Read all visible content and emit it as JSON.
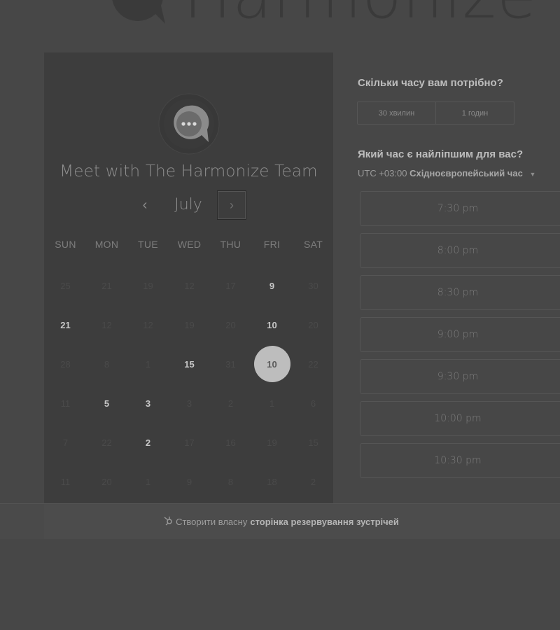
{
  "brand": {
    "name": "Harmonize"
  },
  "calendar": {
    "title": "Meet with The Harmonize Team",
    "month": "July",
    "prev_icon": "‹",
    "next_icon": "›",
    "weekdays": [
      "SUN",
      "MON",
      "TUE",
      "WED",
      "THU",
      "FRI",
      "SAT"
    ],
    "weeks": [
      [
        "25",
        "21",
        "19",
        "12",
        "17",
        "9",
        "30"
      ],
      [
        "21",
        "12",
        "12",
        "19",
        "20",
        "10",
        "20"
      ],
      [
        "28",
        "8",
        "1",
        "15",
        "31",
        "10",
        "22"
      ],
      [
        "11",
        "5",
        "3",
        "3",
        "2",
        "1",
        "6"
      ],
      [
        "7",
        "22",
        "2",
        "17",
        "16",
        "19",
        "15"
      ],
      [
        "11",
        "20",
        "1",
        "9",
        "8",
        "18",
        "2"
      ]
    ],
    "available": [
      [
        0,
        5
      ],
      [
        1,
        0
      ],
      [
        1,
        5
      ],
      [
        2,
        3
      ],
      [
        2,
        5
      ],
      [
        3,
        1
      ],
      [
        3,
        2
      ],
      [
        4,
        2
      ]
    ],
    "selected": [
      2,
      5
    ]
  },
  "booking": {
    "duration_question": "Скільки часу вам потрібно?",
    "durations": [
      "30 хвилин",
      "1 годин"
    ],
    "time_question": "Який час є найліпшим для вас?",
    "timezone_offset": "UTC +03:00",
    "timezone_name": "Східноєвропейський час",
    "slots": [
      "7:30 pm",
      "8:00 pm",
      "8:30 pm",
      "9:00 pm",
      "9:30 pm",
      "10:00 pm",
      "10:30 pm"
    ]
  },
  "footer": {
    "prefix": "Створити власну",
    "link": "сторінка резервування зустрічей"
  }
}
